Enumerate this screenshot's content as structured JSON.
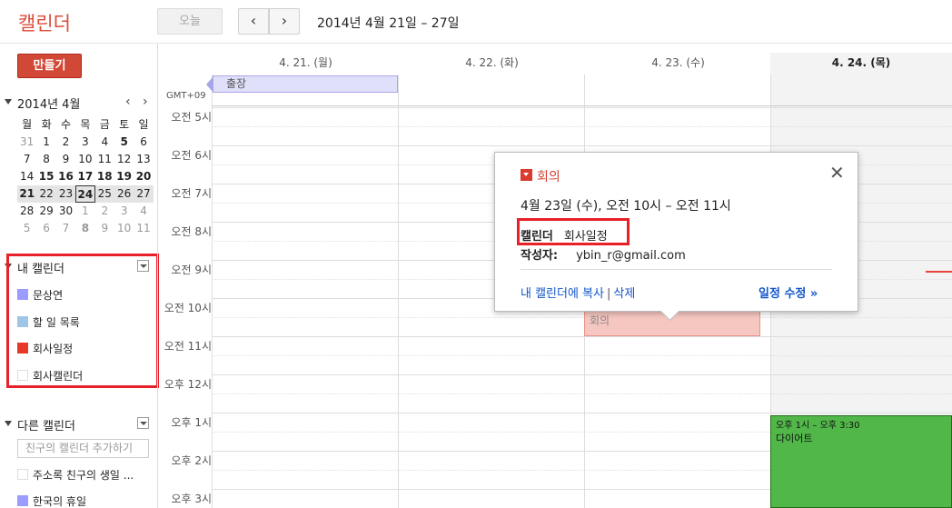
{
  "header": {
    "app_title": "캘린더",
    "today_label": "오늘",
    "prev_label": "‹",
    "next_label": "›",
    "date_range": "2014년 4월 21일 – 27일"
  },
  "sidebar": {
    "create_label": "만들기",
    "mini_calendar": {
      "title": "2014년 4월",
      "prev": "‹",
      "next": "›",
      "weekdays": [
        "월",
        "화",
        "수",
        "목",
        "금",
        "토",
        "일"
      ],
      "weeks": [
        [
          "31",
          "1",
          "2",
          "3",
          "4",
          "5",
          "6"
        ],
        [
          "7",
          "8",
          "9",
          "10",
          "11",
          "12",
          "13"
        ],
        [
          "14",
          "15",
          "16",
          "17",
          "18",
          "19",
          "20"
        ],
        [
          "21",
          "22",
          "23",
          "24",
          "25",
          "26",
          "27"
        ],
        [
          "28",
          "29",
          "30",
          "1",
          "2",
          "3",
          "4"
        ],
        [
          "5",
          "6",
          "7",
          "8",
          "9",
          "10",
          "11"
        ]
      ]
    },
    "my_calendars": {
      "title": "내 캘린더",
      "items": [
        {
          "label": "문상연",
          "color": "#9a9cff"
        },
        {
          "label": "할 일 목록",
          "color": "#9fc6e7"
        },
        {
          "label": "회사일정",
          "color": "#e8372a"
        },
        {
          "label": "회사캘린더",
          "color": "#ffffff"
        }
      ]
    },
    "other_calendars": {
      "title": "다른 캘린더",
      "add_placeholder": "친구의 캘린더 추가하기",
      "items": [
        {
          "label": "주소록 친구의 생일 ...",
          "color": "#ffffff"
        },
        {
          "label": "한국의 휴일",
          "color": "#9a9cff"
        }
      ]
    }
  },
  "week": {
    "days": [
      "4. 21. (월)",
      "4. 22. (화)",
      "4. 23. (수)",
      "4. 24. (목)"
    ],
    "timezone": "GMT+09",
    "hours": [
      "오전 5시",
      "오전 6시",
      "오전 7시",
      "오전 8시",
      "오전 9시",
      "오전 10시",
      "오전 11시",
      "오후 12시",
      "오후 1시",
      "오후 2시",
      "오후 3시"
    ]
  },
  "events": {
    "allday_trip": "출장",
    "meeting": "회의",
    "diet_time": "오후 1시 – 오후 3:30",
    "diet_title": "다이어트"
  },
  "popup": {
    "title": "회의",
    "when": "4월 23일 (수), 오전 10시 – 오전 11시",
    "calendar_label": "캘린더",
    "calendar_value": "회사일정",
    "author_label": "작성자:",
    "author_value": "ybin_r@gmail.com",
    "copy_link": "내 캘린더에 복사",
    "separator": "|",
    "delete_link": "삭제",
    "edit_link": "일정 수정 »"
  }
}
